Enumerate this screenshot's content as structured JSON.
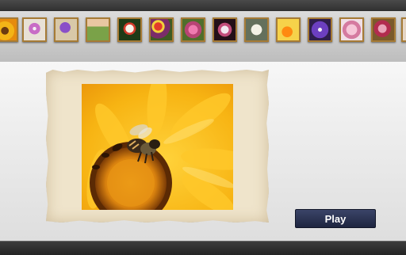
{
  "colors": {
    "top_bar": "#2f2f2f",
    "thumb_bar": "#c9c9c9",
    "thumb_border": "#a67b36",
    "frame_paper": "#efe4cb",
    "play_button": "#2b3354",
    "bottom_bar": "#2a2a2a"
  },
  "thumbnails": [
    {
      "icon": "sunflower-thumb-icon"
    },
    {
      "icon": "pink-flower-thumb-icon"
    },
    {
      "icon": "purple-flower-thumb-icon"
    },
    {
      "icon": "cactus-flower-thumb-icon"
    },
    {
      "icon": "white-flowers-thumb-icon"
    },
    {
      "icon": "red-bouquet-thumb-icon"
    },
    {
      "icon": "pink-bouquet-thumb-icon"
    },
    {
      "icon": "lily-thumb-icon"
    },
    {
      "icon": "white-bouquet-thumb-icon"
    },
    {
      "icon": "orange-flower-thumb-icon"
    },
    {
      "icon": "violet-flower-thumb-icon"
    },
    {
      "icon": "pink-blossom-thumb-icon"
    },
    {
      "icon": "red-pink-bouquet-thumb-icon"
    },
    {
      "icon": "partial-thumb-icon"
    }
  ],
  "main_photo": {
    "icon": "bee-on-sunflower-photo"
  },
  "play_button": {
    "label": "Play"
  }
}
